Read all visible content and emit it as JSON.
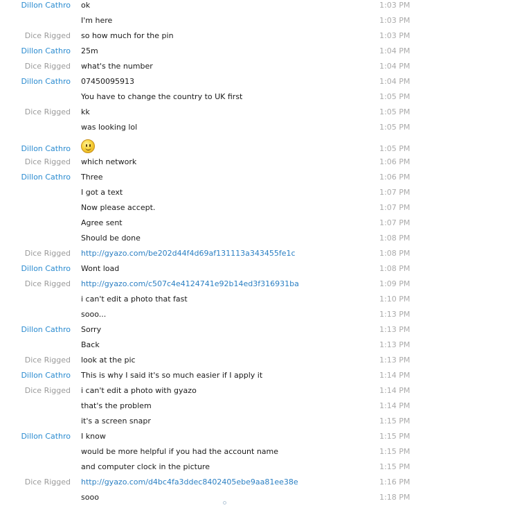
{
  "messages": [
    {
      "sender": "Dillon Cathro",
      "text": "ok",
      "time": "1:03 PM"
    },
    {
      "sender": "",
      "text": "I'm here",
      "time": "1:03 PM"
    },
    {
      "sender": "Dice Rigged",
      "text": "so how much for the pin",
      "time": "1:03 PM"
    },
    {
      "sender": "Dillon Cathro",
      "text": "25m",
      "time": "1:04 PM"
    },
    {
      "sender": "Dice Rigged",
      "text": "what's the number",
      "time": "1:04 PM"
    },
    {
      "sender": "Dillon Cathro",
      "text": "07450095913",
      "time": "1:04 PM"
    },
    {
      "sender": "",
      "text": "You have to change the country to UK first",
      "time": "1:05 PM"
    },
    {
      "sender": "Dice Rigged",
      "text": "kk",
      "time": "1:05 PM"
    },
    {
      "sender": "",
      "text": "was looking lol",
      "time": "1:05 PM"
    },
    {
      "sender": "Dillon Cathro",
      "text": "",
      "emoticon": "smile-emoticon",
      "time": "1:05 PM"
    },
    {
      "sender": "Dice Rigged",
      "text": "which network",
      "time": "1:06 PM"
    },
    {
      "sender": "Dillon Cathro",
      "text": "Three",
      "time": "1:06 PM"
    },
    {
      "sender": "",
      "text": "I got a text",
      "time": "1:07 PM"
    },
    {
      "sender": "",
      "text": "Now please accept.",
      "time": "1:07 PM"
    },
    {
      "sender": "",
      "text": "Agree sent",
      "time": "1:07 PM"
    },
    {
      "sender": "",
      "text": "Should be done",
      "time": "1:08 PM"
    },
    {
      "sender": "Dice Rigged",
      "text": "http://gyazo.com/be202d44f4d69af131113a343455fe1c",
      "link": true,
      "time": "1:08 PM"
    },
    {
      "sender": "Dillon Cathro",
      "text": "Wont load",
      "time": "1:08 PM"
    },
    {
      "sender": "Dice Rigged",
      "text": "http://gyazo.com/c507c4e4124741e92b14ed3f316931ba",
      "link": true,
      "time": "1:09 PM"
    },
    {
      "sender": "",
      "text": "i can't edit a photo that fast",
      "time": "1:10 PM"
    },
    {
      "sender": "",
      "text": "sooo...",
      "time": "1:13 PM"
    },
    {
      "sender": "Dillon Cathro",
      "text": "Sorry",
      "time": "1:13 PM"
    },
    {
      "sender": "",
      "text": "Back",
      "time": "1:13 PM"
    },
    {
      "sender": "Dice Rigged",
      "text": "look at the pic",
      "time": "1:13 PM"
    },
    {
      "sender": "Dillon Cathro",
      "text": "This is why I said it's so much easier if I apply it",
      "time": "1:14 PM"
    },
    {
      "sender": "Dice Rigged",
      "text": "i can't edit a photo with gyazo",
      "time": "1:14 PM"
    },
    {
      "sender": "",
      "text": "that's the problem",
      "time": "1:14 PM"
    },
    {
      "sender": "",
      "text": "it's a screen snapr",
      "time": "1:15 PM"
    },
    {
      "sender": "Dillon Cathro",
      "text": "I know",
      "time": "1:15 PM"
    },
    {
      "sender": "",
      "text": "would be more helpful if you had the account name",
      "time": "1:15 PM"
    },
    {
      "sender": "",
      "text": "and computer clock in the picture",
      "time": "1:15 PM"
    },
    {
      "sender": "Dice Rigged",
      "text": "http://gyazo.com/d4bc4fa3ddec8402405ebe9aa81ee38e",
      "link": true,
      "time": "1:16 PM"
    },
    {
      "sender": "",
      "text": "sooo",
      "time": "1:18 PM"
    }
  ],
  "colors": {
    "dillon_name": "#2a8bd0",
    "dice_name": "#9a9a9a",
    "link": "#2a7fc3",
    "timestamp": "#aaaaaa",
    "text": "#1a1a1a"
  }
}
